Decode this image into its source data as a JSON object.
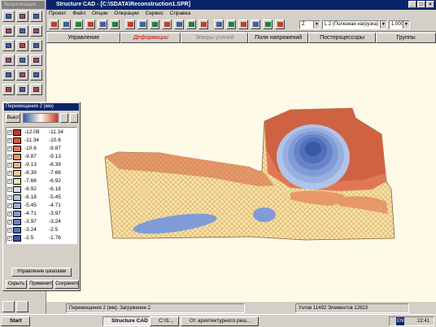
{
  "window": {
    "title": "Structure CAD - [C:\\SDATA\\Reconstruction1.SPR]",
    "controls": [
      "_",
      "□",
      "×"
    ]
  },
  "menu": [
    "Проект",
    "Файл",
    "Опции",
    "Операции",
    "Сервис",
    "Справка"
  ],
  "toolbar": {
    "load_select": "L 2 (Полезная нагрузка)",
    "scale_select": "1.000",
    "z_select": "Z"
  },
  "tabs": [
    {
      "label": "Управление",
      "active": false,
      "disabled": false
    },
    {
      "label": "Деформации",
      "active": true,
      "disabled": false
    },
    {
      "label": "Эпюры усилий",
      "active": false,
      "disabled": true
    },
    {
      "label": "Поля напряжений",
      "active": false,
      "disabled": false
    },
    {
      "label": "Постпроцессоры",
      "active": false,
      "disabled": false
    },
    {
      "label": "Группы",
      "active": false,
      "disabled": false
    }
  ],
  "left_panel": {
    "title": "Визуализация"
  },
  "legend_dialog": {
    "title": "Перемещения 2 (мм)",
    "off_button": "Выкл",
    "rows": [
      {
        "from": "-12.08",
        "to": "-11.34",
        "color": "#c83828"
      },
      {
        "from": "-11.34",
        "to": "-10.6",
        "color": "#d85840"
      },
      {
        "from": "-10.6",
        "to": "-9.87",
        "color": "#e07858"
      },
      {
        "from": "-9.87",
        "to": "-9.13",
        "color": "#e89868"
      },
      {
        "from": "-9.13",
        "to": "-8.39",
        "color": "#f0b080"
      },
      {
        "from": "-8.39",
        "to": "-7.66",
        "color": "#f4c890"
      },
      {
        "from": "-7.66",
        "to": "-6.92",
        "color": "#f8e0a0"
      },
      {
        "from": "-6.92",
        "to": "-6.18",
        "color": "#d8e0f0"
      },
      {
        "from": "-6.18",
        "to": "-5.45",
        "color": "#b0c4e8"
      },
      {
        "from": "-5.45",
        "to": "-4.71",
        "color": "#98b0e0"
      },
      {
        "from": "-4.71",
        "to": "-3.97",
        "color": "#809cd8"
      },
      {
        "from": "-3.97",
        "to": "-3.24",
        "color": "#6884c8"
      },
      {
        "from": "-3.24",
        "to": "-2.5",
        "color": "#5070b8"
      },
      {
        "from": "-2.5",
        "to": "-1.76",
        "color": "#3858a8"
      }
    ],
    "scale_button": "Управление шкалами",
    "hide_button": "Скрыть",
    "apply_button": "Применить",
    "save_button": "Сохранить"
  },
  "status": {
    "mode": "Перемещения 2 (мм). Загружение 2",
    "nodes": "Узлов 11492 Элементов 12623"
  },
  "taskbar": {
    "start": "Start",
    "tasks": [
      "Structure CAD",
      "C:\\S...",
      "От архитектурного реш..."
    ],
    "lang": "EN",
    "clock": "22:41"
  },
  "colors": {
    "canvas_bg": "#fffae8",
    "contour_light": "#f8e0a0",
    "contour_orange": "#e89868",
    "contour_red": "#c85838",
    "contour_blue": "#6884c8",
    "active_tab_text": "#cc0000"
  }
}
